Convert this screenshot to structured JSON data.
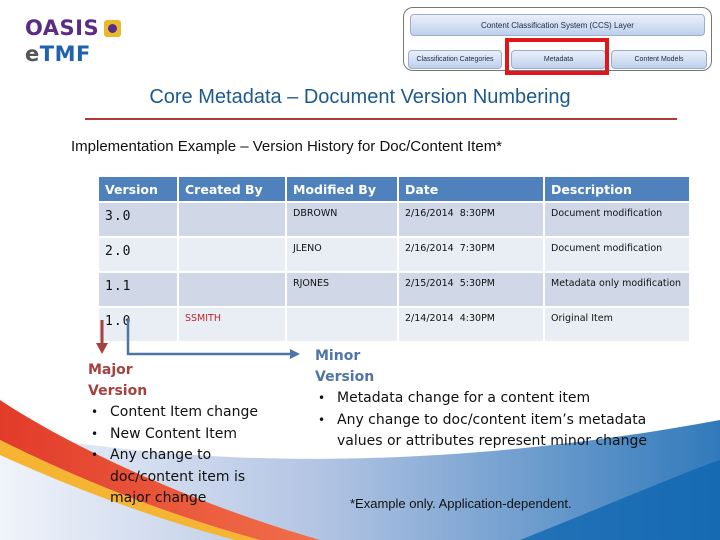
{
  "logo": {
    "org": "OASIS",
    "product_prefix": "e",
    "product_main": "TMF"
  },
  "ccs_diagram": {
    "layer_label": "Content Classification System (CCS) Layer",
    "boxes": [
      "Classification Categories",
      "Metadata",
      "Content Models"
    ],
    "highlighted": "Metadata",
    "highlight_color": "#e0161b"
  },
  "page": {
    "title": "Core Metadata – Document Version Numbering",
    "subtitle": "Implementation Example – Version History for Doc/Content Item*"
  },
  "table": {
    "headers": [
      "Version",
      "Created By",
      "Modified By",
      "Date",
      "Description"
    ],
    "rows": [
      {
        "version": "3.0",
        "created_by": "",
        "modified_by": "DBROWN",
        "date": "2/16/2014  8:30PM",
        "description": "Document modification"
      },
      {
        "version": "2.0",
        "created_by": "",
        "modified_by": "JLENO",
        "date": "2/16/2014  7:30PM",
        "description": "Document modification"
      },
      {
        "version": "1.1",
        "created_by": "",
        "modified_by": "RJONES",
        "date": "2/15/2014  5:30PM",
        "description": "Metadata only modification"
      },
      {
        "version": "1.0",
        "created_by": "SSMITH",
        "modified_by": "",
        "date": "2/14/2014  4:30PM",
        "description": "Original Item"
      }
    ],
    "header_color": "#4f81bd"
  },
  "major": {
    "heading_line1": "Major",
    "heading_line2": "Version",
    "bullets": [
      "Content Item change",
      "New Content Item",
      "Any change to doc/content item is major change"
    ],
    "color": "#a5413f"
  },
  "minor": {
    "heading_line1": "Minor",
    "heading_line2": "Version",
    "bullets": [
      "Metadata change for a content item",
      "Any change to doc/content item’s metadata values or attributes represent minor change"
    ],
    "color": "#4f75a8"
  },
  "footnote": "*Example only.  Application-dependent."
}
